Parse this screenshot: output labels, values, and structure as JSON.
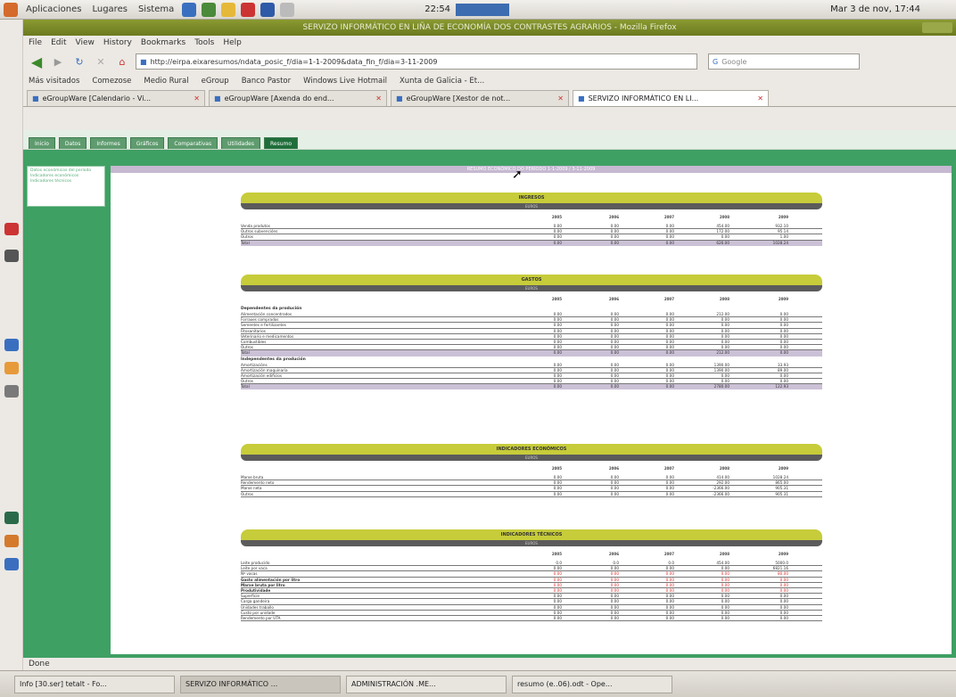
{
  "panel": {
    "apps": "Aplicaciones",
    "places": "Lugares",
    "system": "Sistema",
    "clock": "Mar 3 de nov, 17:44",
    "net": "22:54"
  },
  "window": {
    "title": "SERVIZO INFORMÁTICO EN LIÑA DE ECONOMÍA DOS CONTRASTES AGRARIOS - Mozilla Firefox",
    "menu": [
      "File",
      "Edit",
      "View",
      "History",
      "Bookmarks",
      "Tools",
      "Help"
    ]
  },
  "nav": {
    "url": "http://eirpa.eixaresumos/ndata_posic_f/dia=1-1-2009&data_fin_f/dia=3-11-2009",
    "search_placeholder": "Google"
  },
  "bookmarks": [
    "Más visitados",
    "Comezose",
    "Medio Rural",
    "eGroup",
    "Banco Pastor",
    "Windows Live Hotmail",
    "Xunta de Galicia - Et..."
  ],
  "tabs": [
    {
      "label": "eGroupWare [Calendario - Vi..."
    },
    {
      "label": "eGroupWare [Axenda do end..."
    },
    {
      "label": "eGroupWare [Xestor de not..."
    },
    {
      "label": "SERVIZO INFORMÁTICO EN LI..."
    }
  ],
  "app": {
    "menu_tabs": [
      "Inicio",
      "Datos",
      "Informes",
      "Gráficos",
      "Comparativas",
      "Utilidades",
      "Resumo"
    ],
    "band_text": "RESUMO ECONÓMICO DO PERÍODO 1-1-2009 / 3-11-2009",
    "sidebar": [
      "Datos económicos del período",
      "Indicadores económicos",
      "Indicadores técnicos"
    ]
  },
  "report": {
    "years": [
      "2005",
      "2006",
      "2007",
      "2008",
      "2009"
    ],
    "ingresos": {
      "title": "INGRESOS",
      "sub": "EUROS",
      "rows": [
        {
          "label": "Venda produtos",
          "v": [
            "0.00",
            "0.00",
            "0.00",
            "454.00",
            "932.10"
          ]
        },
        {
          "label": "Outros subvencións",
          "v": [
            "0.00",
            "0.00",
            "0.00",
            "172.00",
            "95.14"
          ]
        },
        {
          "label": "Outros",
          "v": [
            "0.00",
            "0.00",
            "0.00",
            "0.00",
            "1.00"
          ]
        }
      ],
      "total": {
        "label": "Total",
        "v": [
          "0.00",
          "0.00",
          "0.00",
          "626.00",
          "1028.24"
        ]
      }
    },
    "gastos": {
      "title": "GASTOS",
      "sub": "EUROS",
      "sub1": "Dependentes da produción",
      "rows1": [
        {
          "label": "Alimentación concentrados",
          "v": [
            "0.00",
            "0.00",
            "0.00",
            "212.00",
            "0.00"
          ]
        },
        {
          "label": "Forraxes comprados",
          "v": [
            "0.00",
            "0.00",
            "0.00",
            "0.00",
            "0.00"
          ]
        },
        {
          "label": "Sementes e fertilizantes",
          "v": [
            "0.00",
            "0.00",
            "0.00",
            "0.00",
            "0.00"
          ]
        },
        {
          "label": "Fitosanitarios",
          "v": [
            "0.00",
            "0.00",
            "0.00",
            "0.00",
            "0.00"
          ]
        },
        {
          "label": "Veterinario e medicamentos",
          "v": [
            "0.00",
            "0.00",
            "0.00",
            "0.00",
            "0.00"
          ]
        },
        {
          "label": "Combustibles",
          "v": [
            "0.00",
            "0.00",
            "0.00",
            "0.00",
            "0.00"
          ]
        },
        {
          "label": "Outros",
          "v": [
            "0.00",
            "0.00",
            "0.00",
            "0.00",
            "0.00"
          ]
        }
      ],
      "total1": {
        "label": "Total",
        "v": [
          "0.00",
          "0.00",
          "0.00",
          "212.00",
          "0.00"
        ]
      },
      "sub2": "Independentes da produción",
      "rows2": [
        {
          "label": "Amortizacións",
          "v": [
            "0.00",
            "0.00",
            "0.00",
            "1390.00",
            "33.93"
          ]
        },
        {
          "label": "Amortización maquinaria",
          "v": [
            "0.00",
            "0.00",
            "0.00",
            "1390.00",
            "89.00"
          ]
        },
        {
          "label": "Amortización edificios",
          "v": [
            "0.00",
            "0.00",
            "0.00",
            "0.00",
            "0.00"
          ]
        },
        {
          "label": "Outros",
          "v": [
            "0.00",
            "0.00",
            "0.00",
            "0.00",
            "0.00"
          ]
        }
      ],
      "total2": {
        "label": "Total",
        "v": [
          "0.00",
          "0.00",
          "0.00",
          "2780.00",
          "122.93"
        ]
      }
    },
    "indecon": {
      "title": "INDICADORES ECONÓMICOS",
      "sub": "EUROS",
      "rows": [
        {
          "label": "Marxe bruta",
          "v": [
            "0.00",
            "0.00",
            "0.00",
            "414.00",
            "1028.24"
          ]
        },
        {
          "label": "Rendemento neto",
          "v": [
            "0.00",
            "0.00",
            "0.00",
            "292.00",
            "865.00"
          ]
        },
        {
          "label": "Marxe neta",
          "v": [
            "0.00",
            "0.00",
            "0.00",
            "-2366.00",
            "905.31"
          ]
        },
        {
          "label": "Outros",
          "v": [
            "0.00",
            "0.00",
            "0.00",
            "-2366.00",
            "905.31"
          ]
        }
      ]
    },
    "indtec": {
      "title": "INDICADORES TÉCNICOS",
      "sub": "EUROS",
      "rows": [
        {
          "label": "Leite producido",
          "v": [
            "0.0",
            "0.0",
            "0.0",
            "454.00",
            "5000.0"
          ],
          "red": false
        },
        {
          "label": "Leite por vaca",
          "v": [
            "0.00",
            "0.00",
            "0.00",
            "0.00",
            "6821.16"
          ],
          "red": false
        },
        {
          "label": "Nº vacas",
          "v": [
            "0.00",
            "0.00",
            "0.00",
            "0.00",
            "80.00"
          ],
          "red": true
        },
        {
          "label": "Gasto alimentación por litro",
          "v": [
            "0.00",
            "0.00",
            "0.00",
            "0.00",
            "0.00"
          ],
          "red": true,
          "bold": true
        },
        {
          "label": "Marxe bruta por litro",
          "v": [
            "0.00",
            "0.00",
            "0.00",
            "0.00",
            "0.00"
          ],
          "red": true,
          "bold": true
        },
        {
          "label": "Produtividade",
          "v": [
            "0.00",
            "0.00",
            "0.00",
            "0.00",
            "0.00"
          ],
          "red": true,
          "bold": true
        },
        {
          "label": "Superficie",
          "v": [
            "0.00",
            "0.00",
            "0.00",
            "0.00",
            "0.00"
          ],
          "red": false
        },
        {
          "label": "Carga gandeira",
          "v": [
            "0.00",
            "0.00",
            "0.00",
            "0.00",
            "0.00"
          ],
          "red": false
        },
        {
          "label": "Unidades traballo",
          "v": [
            "0.00",
            "0.00",
            "0.00",
            "0.00",
            "0.00"
          ],
          "red": false
        },
        {
          "label": "Custo por unidade",
          "v": [
            "0.00",
            "0.00",
            "0.00",
            "0.00",
            "0.00"
          ],
          "red": false
        },
        {
          "label": "Rendemento por UTA",
          "v": [
            "0.00",
            "0.00",
            "0.00",
            "0.00",
            "0.00"
          ],
          "red": false
        }
      ]
    }
  },
  "status": "Done",
  "taskbar": [
    "Info [30.ser] tetalt - Fo...",
    "SERVIZO INFORMÁTICO ...",
    "ADMINISTRACIÓN .ME...",
    "resumo (e..06).odt - Ope..."
  ]
}
